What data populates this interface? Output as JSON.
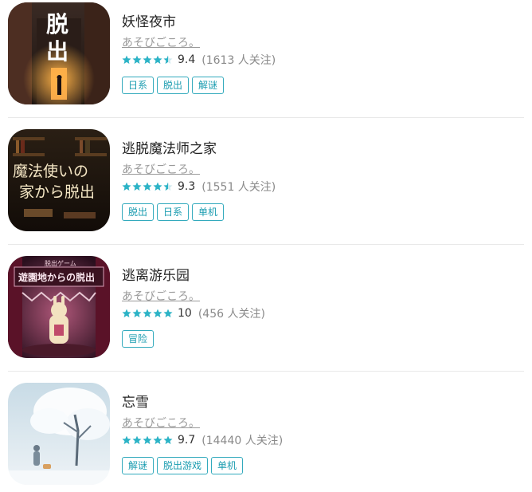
{
  "apps": [
    {
      "title": "妖怪夜市",
      "developer": "あそびごころ。",
      "score": "9.4",
      "followers": "(1613 人关注)",
      "stars": 4.5,
      "tags": [
        "日系",
        "脱出",
        "解谜"
      ],
      "icon_text": [
        "脱",
        "出"
      ]
    },
    {
      "title": "逃脱魔法师之家",
      "developer": "あそびごころ。",
      "score": "9.3",
      "followers": "(1551 人关注)",
      "stars": 4.5,
      "tags": [
        "脱出",
        "日系",
        "单机"
      ],
      "icon_text": [
        "魔法使いの",
        "家から脱出"
      ]
    },
    {
      "title": "逃离游乐园",
      "developer": "あそびごころ。",
      "score": "10",
      "followers": "(456 人关注)",
      "stars": 5,
      "tags": [
        "冒险"
      ],
      "icon_text": [
        "脱出ゲーム",
        "遊園地からの脱出"
      ]
    },
    {
      "title": "忘雪",
      "developer": "あそびごころ。",
      "score": "9.7",
      "followers": "(14440 人关注)",
      "stars": 5,
      "tags": [
        "解谜",
        "脱出游戏",
        "单机"
      ],
      "icon_text": []
    }
  ],
  "colors": {
    "star": "#2bb3c6",
    "tag": "#1a9cb0"
  }
}
